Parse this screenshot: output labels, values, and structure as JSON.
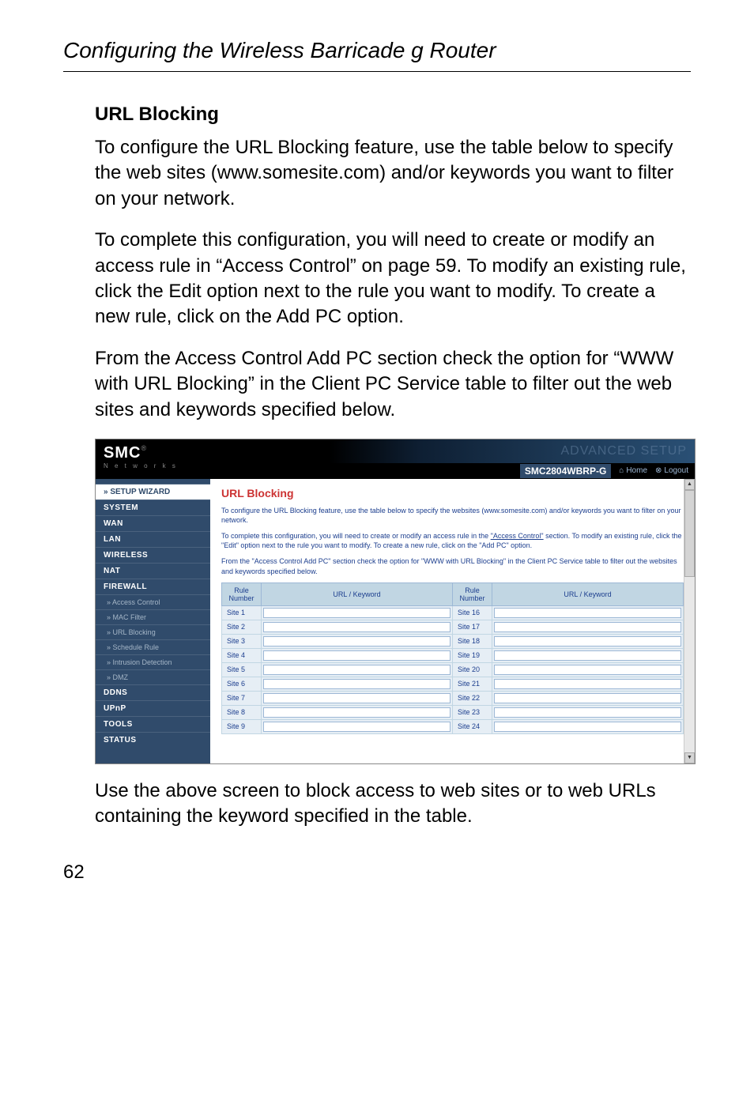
{
  "page_title": "Configuring the Wireless Barricade g Router",
  "section_heading": "URL Blocking",
  "paragraphs": {
    "p1": "To configure the URL Blocking feature, use the table below to specify the web sites (www.somesite.com) and/or keywords you want to filter on your network.",
    "p2": "To complete this configuration, you will need to create or modify an access rule in “Access Control” on page 59. To modify an existing rule, click the Edit option next to the rule you want to modify. To create a new rule, click on the Add PC option.",
    "p3": "From the Access Control Add PC section check the option for “WWW with URL Blocking” in the Client PC Service table to filter out the web sites and keywords specified below.",
    "p4": "Use the above screen to block access to web sites or to web URLs containing the keyword specified in the table."
  },
  "screenshot": {
    "logo": "SMC",
    "logo_sub": "N e t w o r k s",
    "banner_text": "ADVANCED SETUP",
    "model": "SMC2804WBRP-G",
    "home_btn": "Home",
    "logout_btn": "Logout",
    "sidebar": [
      {
        "label": "» SETUP WIZARD",
        "class": "wizard"
      },
      {
        "label": "SYSTEM",
        "class": "major"
      },
      {
        "label": "WAN",
        "class": "major"
      },
      {
        "label": "LAN",
        "class": "major"
      },
      {
        "label": "WIRELESS",
        "class": "major"
      },
      {
        "label": "NAT",
        "class": "major"
      },
      {
        "label": "FIREWALL",
        "class": "major"
      },
      {
        "label": "» Access Control",
        "class": "sub"
      },
      {
        "label": "» MAC Filter",
        "class": "sub"
      },
      {
        "label": "» URL Blocking",
        "class": "sub"
      },
      {
        "label": "» Schedule Rule",
        "class": "sub"
      },
      {
        "label": "» Intrusion Detection",
        "class": "sub"
      },
      {
        "label": "» DMZ",
        "class": "sub"
      },
      {
        "label": "DDNS",
        "class": "major"
      },
      {
        "label": "UPnP",
        "class": "major"
      },
      {
        "label": "TOOLS",
        "class": "major"
      },
      {
        "label": "STATUS",
        "class": "major"
      }
    ],
    "panel": {
      "title": "URL Blocking",
      "text1": "To configure the URL Blocking feature, use the table below to specify the websites (www.somesite.com) and/or keywords you want to filter on your network.",
      "text2_pre": "To complete this configuration, you will need to create or modify an access rule in the ",
      "text2_link": "\"Access Control\"",
      "text2_post": " section. To modify an existing rule, click the \"Edit\" option next to the rule you want to modify. To create a new rule, click on the \"Add PC\" option.",
      "text3": "From the \"Access Control Add PC\" section check the option for \"WWW with URL Blocking\" in the Client PC Service table to filter out the websites and keywords specified below.",
      "table": {
        "col1": "Rule Number",
        "col2": "URL / Keyword",
        "col3": "Rule Number",
        "col4": "URL / Keyword",
        "rows": [
          {
            "left": "Site 1",
            "right": "Site 16"
          },
          {
            "left": "Site 2",
            "right": "Site 17"
          },
          {
            "left": "Site 3",
            "right": "Site 18"
          },
          {
            "left": "Site 4",
            "right": "Site 19"
          },
          {
            "left": "Site 5",
            "right": "Site 20"
          },
          {
            "left": "Site 6",
            "right": "Site 21"
          },
          {
            "left": "Site 7",
            "right": "Site 22"
          },
          {
            "left": "Site 8",
            "right": "Site 23"
          },
          {
            "left": "Site 9",
            "right": "Site 24"
          }
        ]
      }
    }
  },
  "page_number": "62"
}
